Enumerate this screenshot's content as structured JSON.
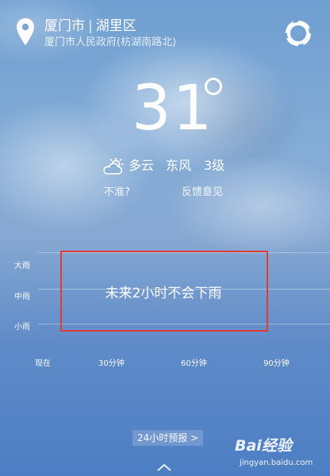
{
  "header": {
    "city": "厦门市",
    "district": "湖里区",
    "address": "厦门市人民政府(枋湖南路北)",
    "location_icon": "location-pin-icon",
    "app_icon": "swirl-logo-icon"
  },
  "current": {
    "temperature": "31",
    "condition_icon": "partly-cloudy-icon",
    "condition": "多云",
    "wind_direction": "东风",
    "wind_level": "3级",
    "inaccurate_link": "不准?",
    "feedback_link": "反馈意见"
  },
  "rain_chart": {
    "y_labels": [
      "大雨",
      "中雨",
      "小雨"
    ],
    "x_labels": [
      "现在",
      "30分钟",
      "60分钟",
      "90分钟"
    ],
    "message": "未来2小时不会下雨",
    "highlight_color": "#e53935"
  },
  "footer": {
    "forecast_button": "24小时预报 >",
    "expand_icon": "chevron-up-icon"
  },
  "watermark": {
    "logo": "Bai经验",
    "url": "jingyan.baidu.com"
  }
}
